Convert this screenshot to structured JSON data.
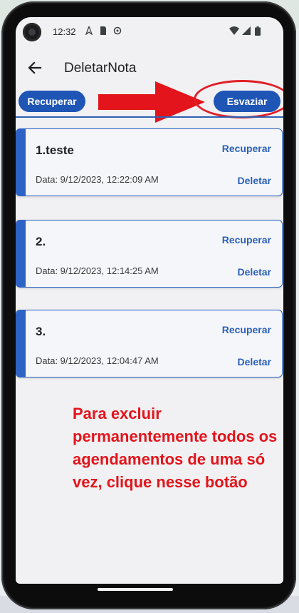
{
  "status_bar": {
    "time": "12:32",
    "icons": [
      "navigation-icon",
      "sim-card-icon",
      "sync-icon",
      "wifi-icon",
      "signal-icon",
      "battery-icon"
    ]
  },
  "app_bar": {
    "title": "DeletarNota"
  },
  "toolbar": {
    "recover_label": "Recuperar",
    "empty_label": "Esvaziar"
  },
  "notes": [
    {
      "title": "1.teste",
      "date": "Data: 9/12/2023, 12:22:09 AM",
      "recover": "Recuperar",
      "delete": "Deletar"
    },
    {
      "title": "2.",
      "date": "Data: 9/12/2023, 12:14:25 AM",
      "recover": "Recuperar",
      "delete": "Deletar"
    },
    {
      "title": "3.",
      "date": "Data: 9/12/2023, 12:04:47 AM",
      "recover": "Recuperar",
      "delete": "Deletar"
    }
  ],
  "annotation": {
    "text": "Para excluir permanentemente todos os agendamentos de uma só vez, clique nesse botão"
  },
  "colors": {
    "accent": "#1f56b6",
    "annotation_red": "#e3141b"
  }
}
